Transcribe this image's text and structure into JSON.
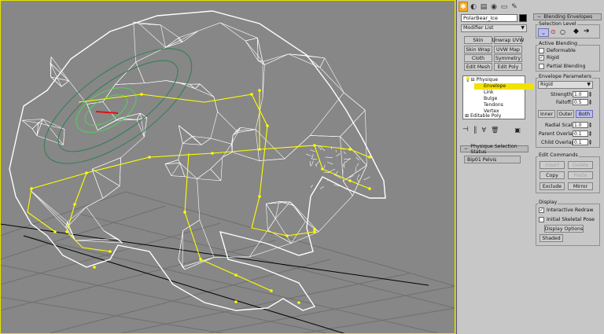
{
  "colors": {
    "viewport_bg": "#878787",
    "wire": "#ffffff",
    "bones": "#ffff00",
    "envelope": "#2e7f54",
    "envelope_active": "#4ed457",
    "selected_bone": "#e01010",
    "panel_bg": "#c7c7c7",
    "active_tab": "#f2a82c",
    "highlight": "#f1e200",
    "button_on": "#bcbde9"
  },
  "command_panel": {
    "tabs": [
      {
        "icon": "create-icon",
        "glyph": "✱"
      },
      {
        "icon": "modify-icon",
        "glyph": "◐"
      },
      {
        "icon": "hierarchy-icon",
        "glyph": "▤"
      },
      {
        "icon": "motion-icon",
        "glyph": "◉"
      },
      {
        "icon": "display-icon",
        "glyph": "▭"
      },
      {
        "icon": "utilities-icon",
        "glyph": "✎"
      }
    ],
    "object_name": "PolarBear_Ice",
    "modifier_list": "Modifier List",
    "modifier_buttons": [
      "Skin",
      "Unwrap UVW",
      "Skin Wrap",
      "UVW Map",
      "Cloth",
      "Symmetry",
      "Edit Mesh",
      "Edit Poly"
    ],
    "stack": {
      "items": [
        "Physique",
        "Envelope",
        "Link",
        "Bulge",
        "Tendons",
        "Vertex",
        "Editable Poly"
      ]
    },
    "stack_tools": [
      "pin-stack-icon",
      "show-end-result-icon",
      "make-unique-icon",
      "remove-modifier-icon",
      "configure-sets-icon"
    ],
    "selection_status": {
      "title": "Physique Selection Status",
      "value": "Bip01 Pelvis"
    }
  },
  "blending": {
    "title": "Blending Envelopes",
    "selection_level": {
      "title": "Selection Level"
    },
    "active_blending": {
      "title": "Active Blending",
      "items": [
        {
          "label": "Deformable",
          "checked": false
        },
        {
          "label": "Rigid",
          "checked": true
        },
        {
          "label": "Partial Blending",
          "checked": false
        }
      ]
    },
    "envelope_params": {
      "title": "Envelope Parameters",
      "type": "Rigid",
      "strength_label": "Strength:",
      "strength": "1.0",
      "falloff_label": "Falloff:",
      "falloff": "0.5",
      "inner": "Inner",
      "outer": "Outer",
      "both": "Both",
      "radial_label": "Radial Scale:",
      "radial": "1.0",
      "parent_label": "Parent Overlap:",
      "parent": "0.1",
      "child_label": "Child Overlap:",
      "child": "0.1"
    },
    "edit_commands": {
      "title": "Edit Commands",
      "insert": "Insert",
      "delete": "Delete",
      "copy": "Copy",
      "paste": "Paste",
      "exclude": "Exclude",
      "mirror": "Mirror"
    },
    "display": {
      "title": "Display",
      "interactive": "Interactive Redraw",
      "interactive_checked": true,
      "initial_skeletal": "Initial Skeletal Pose",
      "initial_checked": false,
      "options": "Display Options",
      "shaded": "Shaded"
    }
  }
}
